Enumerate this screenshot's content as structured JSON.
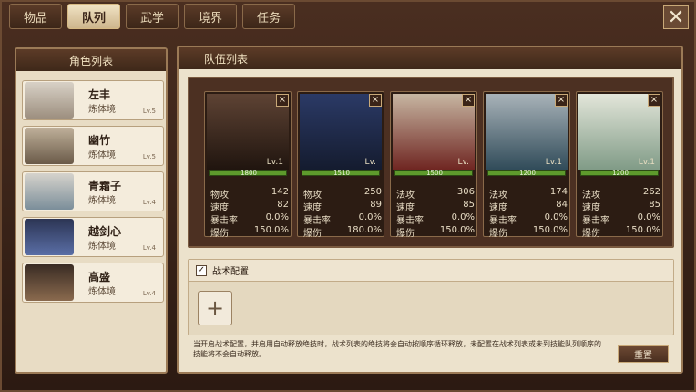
{
  "tabs": [
    "物品",
    "队列",
    "武学",
    "境界",
    "任务"
  ],
  "active_tab_index": 1,
  "close_label": "✕",
  "left_panel": {
    "title": "角色列表",
    "characters": [
      {
        "name": "左丰",
        "realm": "炼体境",
        "level": "Lv.5"
      },
      {
        "name": "幽竹",
        "realm": "炼体境",
        "level": "Lv.5"
      },
      {
        "name": "青霜子",
        "realm": "炼体境",
        "level": "Lv.4"
      },
      {
        "name": "越剑心",
        "realm": "炼体境",
        "level": "Lv.4"
      },
      {
        "name": "高盛",
        "realm": "炼体境",
        "level": "Lv.4"
      }
    ]
  },
  "right_panel": {
    "title": "队伍列表",
    "team": [
      {
        "level": "Lv.1",
        "hp": "1800",
        "stats": [
          [
            "物攻",
            "142"
          ],
          [
            "速度",
            "82"
          ],
          [
            "暴击率",
            "0.0%"
          ],
          [
            "爆伤",
            "150.0%"
          ]
        ]
      },
      {
        "level": "Lv.",
        "hp": "1510",
        "stats": [
          [
            "物攻",
            "250"
          ],
          [
            "速度",
            "89"
          ],
          [
            "暴击率",
            "0.0%"
          ],
          [
            "爆伤",
            "180.0%"
          ]
        ]
      },
      {
        "level": "Lv.",
        "hp": "1500",
        "stats": [
          [
            "法攻",
            "306"
          ],
          [
            "速度",
            "85"
          ],
          [
            "暴击率",
            "0.0%"
          ],
          [
            "爆伤",
            "150.0%"
          ]
        ]
      },
      {
        "level": "Lv.1",
        "hp": "1200",
        "stats": [
          [
            "法攻",
            "174"
          ],
          [
            "速度",
            "84"
          ],
          [
            "暴击率",
            "0.0%"
          ],
          [
            "爆伤",
            "150.0%"
          ]
        ]
      },
      {
        "level": "Lv.1",
        "hp": "1200",
        "stats": [
          [
            "法攻",
            "262"
          ],
          [
            "速度",
            "85"
          ],
          [
            "暴击率",
            "0.0%"
          ],
          [
            "爆伤",
            "150.0%"
          ]
        ]
      }
    ],
    "tactics": {
      "checked": true,
      "label": "战术配置",
      "add_label": "+",
      "note": "当开启战术配置，并启用自动释放绝技时，战术列表的绝技将会自动按顺序循环释放，未配置在战术列表或未到技能队列顺序的技能将不会自动释放。",
      "reset_label": "重置"
    }
  },
  "colors": {
    "accent": "#cdb58c",
    "hp_green": "#5e9a2c",
    "frame": "#4a2e20"
  }
}
